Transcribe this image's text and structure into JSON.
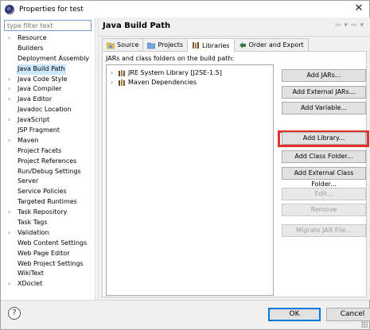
{
  "window": {
    "title": "Properties for test",
    "close_glyph": "✕"
  },
  "filter": {
    "placeholder": "type filter text"
  },
  "nav_tree": {
    "items": [
      {
        "label": "Resource",
        "expandable": true
      },
      {
        "label": "Builders",
        "expandable": false
      },
      {
        "label": "Deployment Assembly",
        "expandable": false
      },
      {
        "label": "Java Build Path",
        "expandable": false,
        "selected": true
      },
      {
        "label": "Java Code Style",
        "expandable": true
      },
      {
        "label": "Java Compiler",
        "expandable": true
      },
      {
        "label": "Java Editor",
        "expandable": true
      },
      {
        "label": "Javadoc Location",
        "expandable": false
      },
      {
        "label": "JavaScript",
        "expandable": true
      },
      {
        "label": "JSP Fragment",
        "expandable": false
      },
      {
        "label": "Maven",
        "expandable": true
      },
      {
        "label": "Project Facets",
        "expandable": false
      },
      {
        "label": "Project References",
        "expandable": false
      },
      {
        "label": "Run/Debug Settings",
        "expandable": false
      },
      {
        "label": "Server",
        "expandable": false
      },
      {
        "label": "Service Policies",
        "expandable": false
      },
      {
        "label": "Targeted Runtimes",
        "expandable": false
      },
      {
        "label": "Task Repository",
        "expandable": true
      },
      {
        "label": "Task Tags",
        "expandable": false
      },
      {
        "label": "Validation",
        "expandable": true
      },
      {
        "label": "Web Content Settings",
        "expandable": false
      },
      {
        "label": "Web Page Editor",
        "expandable": false
      },
      {
        "label": "Web Project Settings",
        "expandable": false
      },
      {
        "label": "WikiText",
        "expandable": false
      },
      {
        "label": "XDoclet",
        "expandable": true
      }
    ]
  },
  "page": {
    "title": "Java Build Path",
    "nav_back": "⇦",
    "nav_menu_a": "▾",
    "nav_forward": "⇨",
    "nav_menu_b": "▾"
  },
  "tabs": [
    {
      "label": "Source",
      "icon": "source-folder-icon",
      "active": false
    },
    {
      "label": "Projects",
      "icon": "projects-icon",
      "active": false
    },
    {
      "label": "Libraries",
      "icon": "libraries-icon",
      "active": true
    },
    {
      "label": "Order and Export",
      "icon": "order-export-icon",
      "active": false
    }
  ],
  "libraries": {
    "heading": "JARs and class folders on the build path:",
    "items": [
      {
        "label": "JRE System Library [J2SE-1.5]",
        "icon": "jre-library-icon"
      },
      {
        "label": "Maven Dependencies",
        "icon": "maven-library-icon"
      }
    ]
  },
  "buttons": {
    "add_jars": "Add JARs...",
    "add_external_jars": "Add External JARs...",
    "add_variable": "Add Variable...",
    "add_library": "Add Library...",
    "add_class_folder": "Add Class Folder...",
    "add_external_class_folder": "Add External Class Folder...",
    "edit": "Edit...",
    "remove": "Remove",
    "migrate_jar": "Migrate JAR File..."
  },
  "dialog": {
    "ok": "OK",
    "cancel": "Cancel",
    "help_glyph": "?"
  },
  "colors": {
    "highlight": "#e2302a",
    "selection": "#cce8ff",
    "default_button_border": "#0078d7"
  }
}
